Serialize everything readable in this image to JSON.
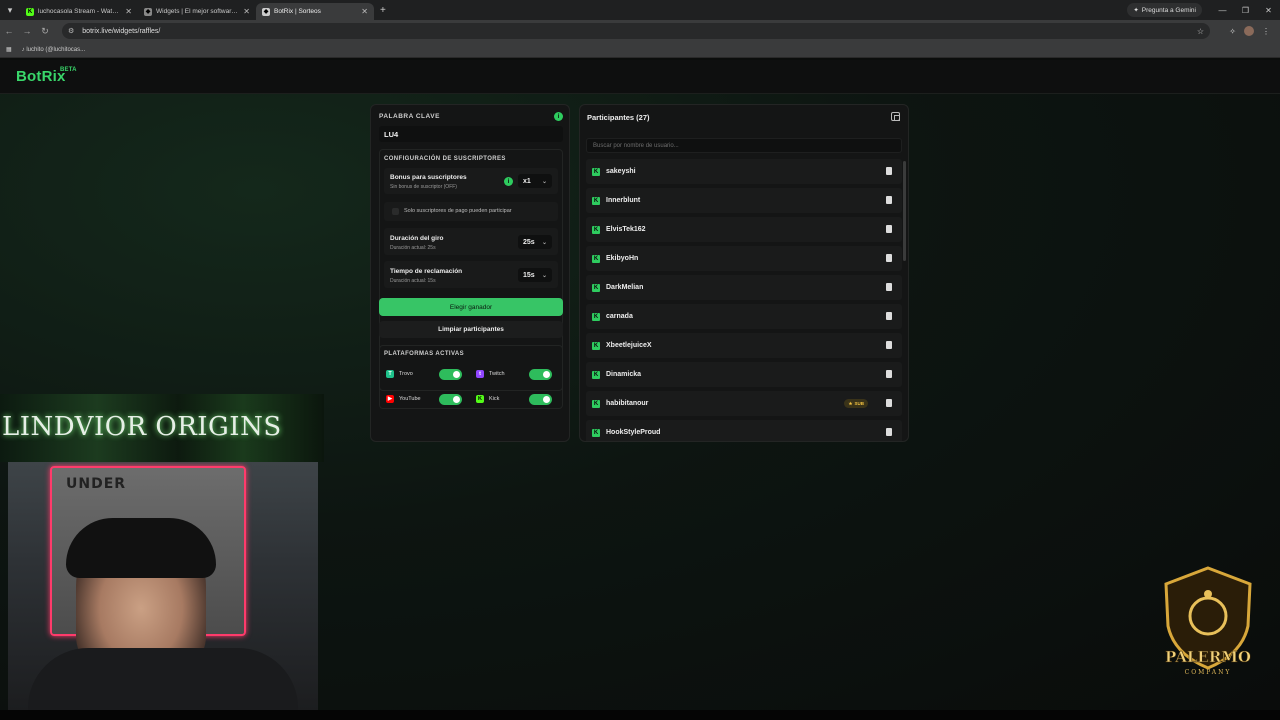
{
  "browser": {
    "tabs": [
      {
        "title": "luchocasola Stream - Watch Live",
        "active": false
      },
      {
        "title": "Widgets | El mejor software para",
        "active": false
      },
      {
        "title": "BotRix | Sorteos",
        "active": true
      }
    ],
    "gemini_label": "Pregunta a Gemini",
    "url": "botrix.live/widgets/raffles/",
    "bookmark": "luchito (@luchitocas..."
  },
  "app": {
    "logo": "BotRix",
    "logo_badge": "BETA"
  },
  "left_panel": {
    "keyword_label": "PALABRA CLAVE",
    "keyword_value": "LU4",
    "subs_title": "CONFIGURACIÓN DE SUSCRIPTORES",
    "bonus_title": "Bonus para suscriptores",
    "bonus_sub": "Sin bonus de suscriptor (OFF)",
    "bonus_value": "x1",
    "paid_only_label": "Solo suscriptores de pago pueden participar",
    "spin_title": "Duración del giro",
    "spin_sub": "Duración actual: 25s",
    "spin_value": "25s",
    "claim_title": "Tiempo de reclamación",
    "claim_sub": "Duración actual: 15s",
    "claim_value": "15s",
    "pick_winner": "Elegir ganador",
    "clear_participants": "Limpiar participantes",
    "platforms_title": "PLATAFORMAS ACTIVAS",
    "platforms": [
      {
        "name": "Trovo",
        "enabled": true,
        "color": "#1ec28b"
      },
      {
        "name": "Twitch",
        "enabled": true,
        "color": "#9146ff"
      },
      {
        "name": "YouTube",
        "enabled": true,
        "color": "#ff0000"
      },
      {
        "name": "Kick",
        "enabled": true,
        "color": "#53fc18"
      }
    ]
  },
  "participants": {
    "title": "Participantes (27)",
    "search_placeholder": "Buscar por nombre de usuario...",
    "items": [
      {
        "name": "sakeyshi"
      },
      {
        "name": "Innerblunt"
      },
      {
        "name": "ElvisTek162"
      },
      {
        "name": "EkibyoHn"
      },
      {
        "name": "DarkMelian"
      },
      {
        "name": "carnada"
      },
      {
        "name": "XbeetlejuiceX"
      },
      {
        "name": "Dinamicka"
      },
      {
        "name": "habibitanour",
        "badge": "SUB"
      },
      {
        "name": "HookStyleProud"
      }
    ]
  },
  "overlay": {
    "banner_text": "LINDVIOR ORIGINS",
    "cam_flag_text": "UNDER",
    "logo_text": "PALERMO",
    "logo_sub": "COMPANY"
  },
  "colors": {
    "accent": "#37c566",
    "kick_green": "#2ecc5f"
  }
}
